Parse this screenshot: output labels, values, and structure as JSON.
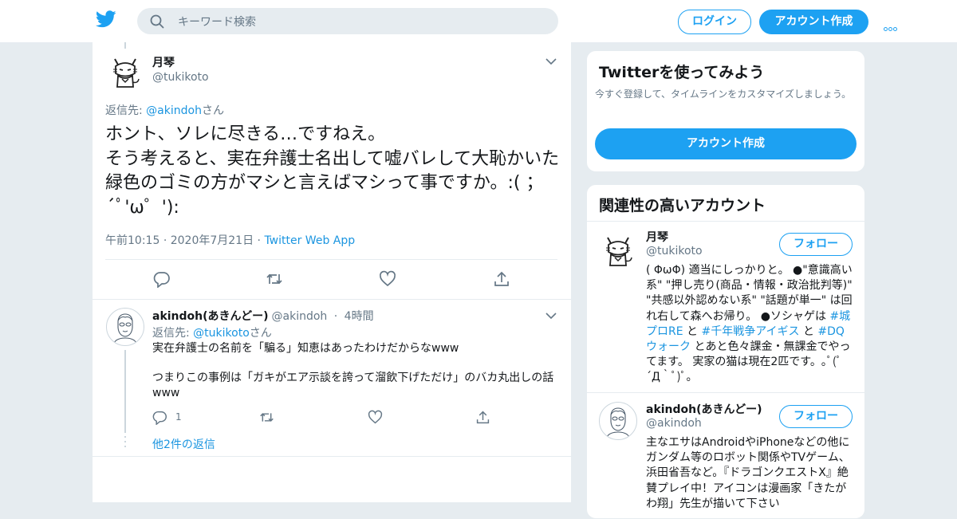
{
  "topbar": {
    "search_placeholder": "キーワード検索",
    "login_label": "ログイン",
    "signup_label": "アカウント作成",
    "brand_color": "#1da1f2"
  },
  "main_tweet": {
    "name": "月琴",
    "handle": "@tukikoto",
    "reply_prefix": "返信先: ",
    "reply_to": "@akindoh",
    "reply_suffix": "さん",
    "text": "ホント、ソレに尽きる…ですねえ。\nそう考えると、実在弁護士名出して嘘バレして大恥かいた緑色のゴミの方がマシと言えばマシって事ですか。:( ；´ﾟ'ω゜'):",
    "time": "午前10:15",
    "date": "2020年7月21日",
    "source": "Twitter Web App"
  },
  "reply_tweet": {
    "name": "akindoh(あきんどー)",
    "handle": "@akindoh",
    "time": "4時間",
    "reply_prefix": "返信先: ",
    "reply_to": "@tukikoto",
    "reply_suffix": "さん",
    "text": "実在弁護士の名前を「騙る」知恵はあったわけだからなwww\n\nつまりこの事例は「ガキがエア示談を誇って溜飲下げただけ」のバカ丸出しの話www",
    "reply_count": "1",
    "more_replies": "他2件の返信"
  },
  "signup_card": {
    "title": "Twitterを使ってみよう",
    "subtitle": "今すぐ登録して、タイムラインをカスタマイズしましょう。",
    "button": "アカウント作成"
  },
  "related": {
    "title": "関連性の高いアカウント",
    "follow_label": "フォロー",
    "accounts": [
      {
        "name": "月琴",
        "handle": "@tukikoto",
        "bio_1": "( ΦωΦ) 適当にしっかりと。 ●\"意識高い系\" \"押し売り(商品・情報・政治批判等)\" \"共感以外認めない系\" \"話題が単一\" は回れ右して森へお帰り。 ●ソシャゲは ",
        "tag_1": "#城プロRE",
        "bio_2": " と ",
        "tag_2": "#千年戦争アイギス",
        "bio_3": " と ",
        "tag_3": "#DQウォーク",
        "bio_4": " とあと色々課金・無課金でやってます。 実家の猫は現在2匹です。｡ﾟ(ﾟ´Д｀ﾟ)ﾟ｡"
      },
      {
        "name": "akindoh(あきんどー)",
        "handle": "@akindoh",
        "bio": "主なエサはAndroidやiPhoneなどの他にガンダム等のロボット関係やTVゲーム、浜田省吾など。『ドラゴンクエストX』絶賛プレイ中！アイコンは漫画家「きたがわ翔」先生が描いて下さい"
      }
    ]
  }
}
